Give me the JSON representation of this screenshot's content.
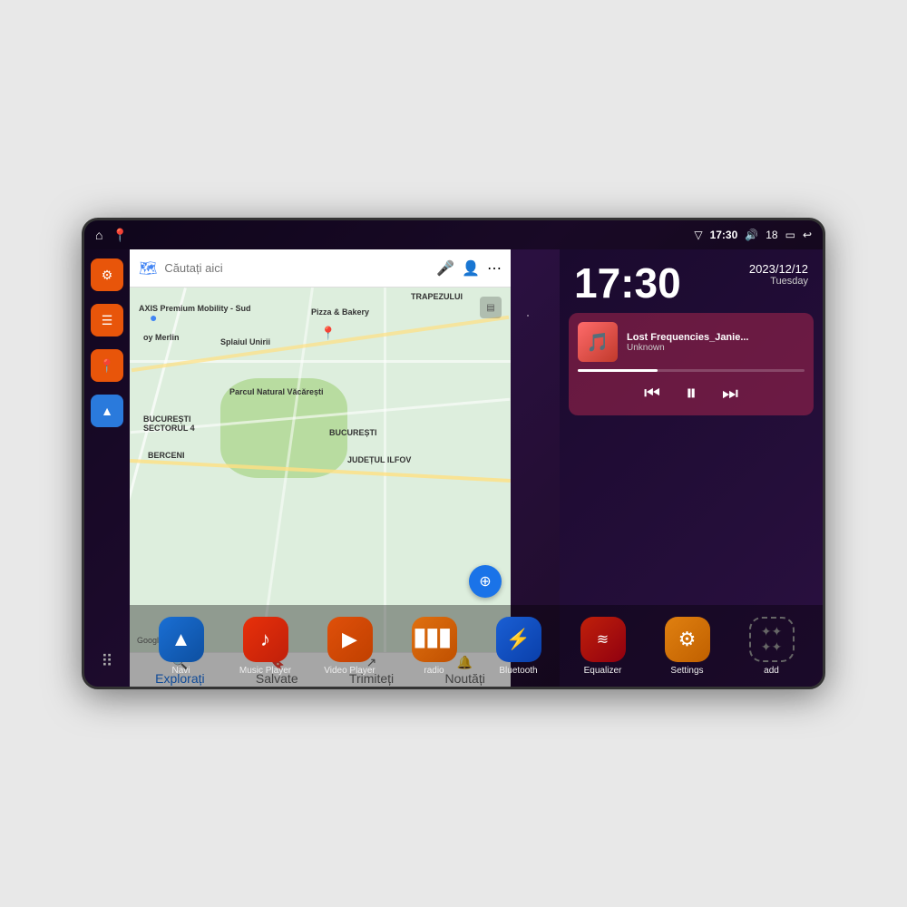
{
  "status_bar": {
    "left_icons": [
      "⌂",
      "📍"
    ],
    "wifi_icon": "▽",
    "time": "17:30",
    "volume_icon": "🔊",
    "battery_num": "18",
    "battery_icon": "▭",
    "back_icon": "↩"
  },
  "sidebar": {
    "settings_label": "settings",
    "files_label": "files",
    "maps_label": "maps",
    "arrow_label": "navigation",
    "apps_label": "apps"
  },
  "map": {
    "search_placeholder": "Căutați aici",
    "area_label": "Parcul Natural Văcărești",
    "sector_label": "BUCUREȘTI SECTORUL 4",
    "berceni_label": "BERCENI",
    "judet_label": "JUDEȚUL ILFOV",
    "bucuresti_label": "BUCUREȘTI",
    "axis_label": "AXIS Premium Mobility - Sud",
    "pizza_label": "Pizza & Bakery",
    "trapezului_label": "TRAPEZULUI",
    "splaiul_label": "Splaiul Unirii",
    "google_label": "Google",
    "bottom_items": [
      {
        "icon": "🔍",
        "label": "Explorați"
      },
      {
        "icon": "🔖",
        "label": "Salvate"
      },
      {
        "icon": "↗",
        "label": "Trimiteți"
      },
      {
        "icon": "🔔",
        "label": "Noutăți"
      }
    ]
  },
  "clock": {
    "time": "17:30",
    "date": "2023/12/12",
    "day": "Tuesday"
  },
  "music": {
    "track_name": "Lost Frequencies_Janie...",
    "artist": "Unknown",
    "prev_icon": "⏮",
    "pause_icon": "⏸",
    "next_icon": "⏭"
  },
  "apps": [
    {
      "id": "navi",
      "label": "Navi",
      "icon": "▲",
      "icon_class": "icon-navi"
    },
    {
      "id": "music-player",
      "label": "Music Player",
      "icon": "♪",
      "icon_class": "icon-music"
    },
    {
      "id": "video-player",
      "label": "Video Player",
      "icon": "▶",
      "icon_class": "icon-video"
    },
    {
      "id": "radio",
      "label": "radio",
      "icon": "📻",
      "icon_class": "icon-radio"
    },
    {
      "id": "bluetooth",
      "label": "Bluetooth",
      "icon": "⚡",
      "icon_class": "icon-bt"
    },
    {
      "id": "equalizer",
      "label": "Equalizer",
      "icon": "≋",
      "icon_class": "icon-eq"
    },
    {
      "id": "settings",
      "label": "Settings",
      "icon": "⚙",
      "icon_class": "icon-settings"
    },
    {
      "id": "add",
      "label": "add",
      "icon": "✦",
      "icon_class": "icon-add"
    }
  ]
}
